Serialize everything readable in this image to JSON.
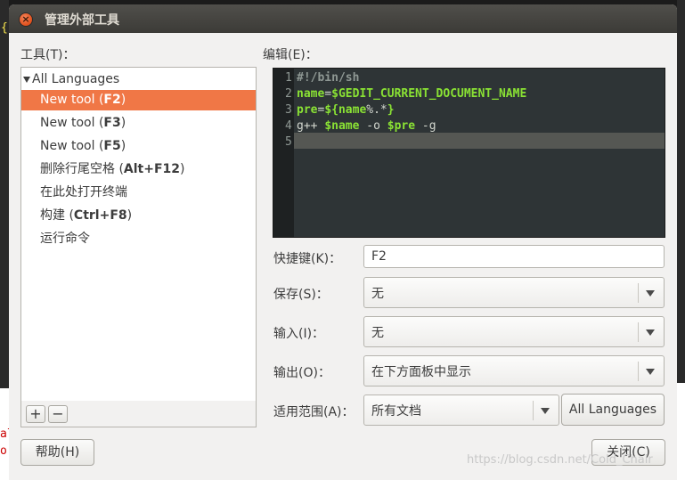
{
  "dialog": {
    "title": "管理外部工具"
  },
  "tools": {
    "label": "工具(T)：",
    "group": "All Languages",
    "items": [
      {
        "prefix": "New tool (",
        "key": "F2",
        "suffix": ")"
      },
      {
        "prefix": "New tool (",
        "key": "F3",
        "suffix": ")"
      },
      {
        "prefix": "New tool (",
        "key": "F5",
        "suffix": ")"
      },
      {
        "prefix": "删除行尾空格 (",
        "key": "Alt+F12",
        "suffix": ")"
      },
      {
        "prefix": "在此处打开终端",
        "key": "",
        "suffix": ""
      },
      {
        "prefix": "构建 (",
        "key": "Ctrl+F8",
        "suffix": ")"
      },
      {
        "prefix": "运行命令",
        "key": "",
        "suffix": ""
      }
    ],
    "add": "+",
    "remove": "−"
  },
  "editor": {
    "label": "编辑(E)：",
    "line_numbers": [
      "1",
      "2",
      "3",
      "4",
      "5"
    ],
    "lines": [
      [
        {
          "t": "#!/bin/sh",
          "c": "com"
        }
      ],
      [
        {
          "t": "name",
          "c": "kw"
        },
        {
          "t": "=",
          "c": "tx"
        },
        {
          "t": "$GEDIT_CURRENT_DOCUMENT_NAME",
          "c": "kw"
        }
      ],
      [
        {
          "t": "pre",
          "c": "kw"
        },
        {
          "t": "=",
          "c": "tx"
        },
        {
          "t": "${name",
          "c": "kw"
        },
        {
          "t": "%.*",
          "c": "tx"
        },
        {
          "t": "}",
          "c": "kw"
        }
      ],
      [
        {
          "t": "g++ ",
          "c": "tx"
        },
        {
          "t": "$name",
          "c": "kw"
        },
        {
          "t": " -o ",
          "c": "tx"
        },
        {
          "t": "$pre",
          "c": "kw"
        },
        {
          "t": " -g",
          "c": "tx"
        }
      ],
      []
    ]
  },
  "form": {
    "shortcut_label": "快捷键(K)：",
    "shortcut_value": "F2",
    "save_label": "保存(S)：",
    "save_value": "无",
    "input_label": "输入(I)：",
    "input_value": "无",
    "output_label": "输出(O)：",
    "output_value": "在下方面板中显示",
    "scope_label": "适用范围(A)：",
    "scope_value": "所有文档",
    "languages_button": "All Languages"
  },
  "buttons": {
    "help": "帮助(H)",
    "close": "关闭(C)"
  },
  "watermark": "https://blog.csdn.net/Cold_Chair",
  "background_fragments": {
    "left_a": "{",
    "left_b": "al",
    "left_c": "or"
  },
  "colors": {
    "selection": "#f07746",
    "editor_bg": "#2e3436",
    "keyword": "#8ae234",
    "titlebar": "#3c3b37"
  }
}
